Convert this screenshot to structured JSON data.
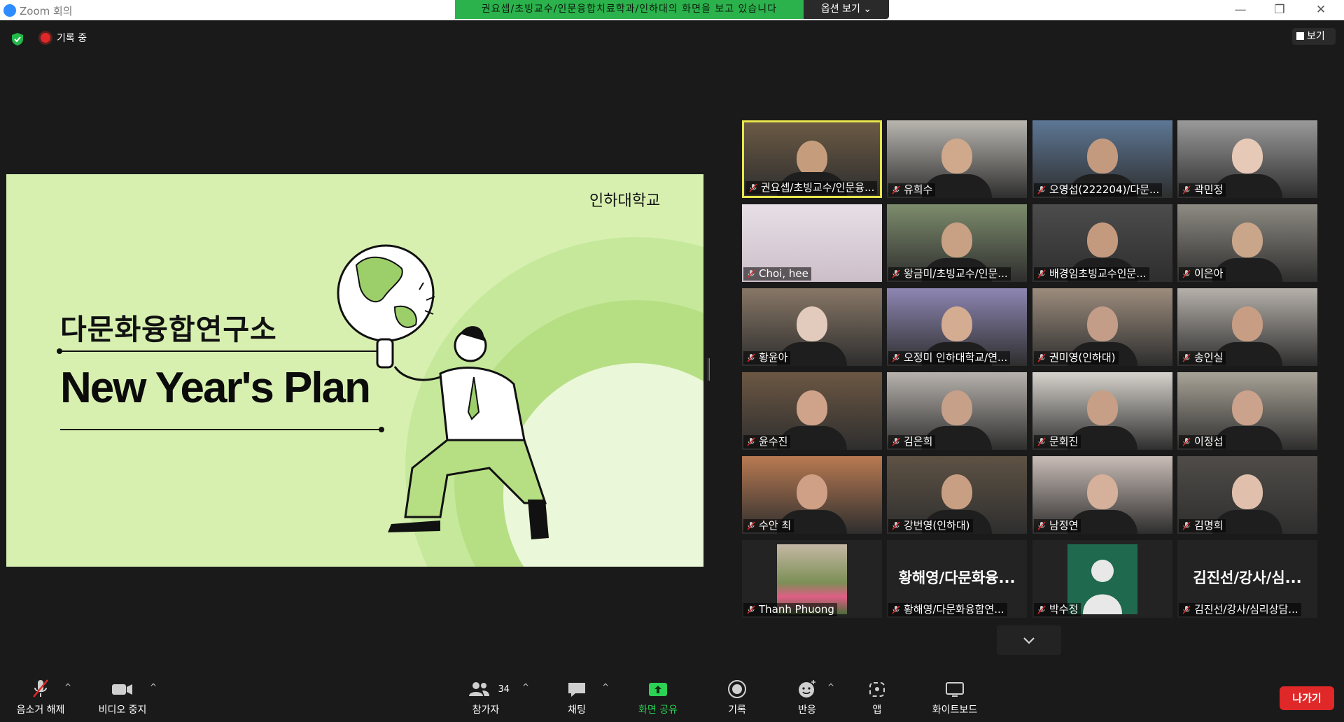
{
  "window": {
    "app_title": "Zoom 회의",
    "share_banner": "권요셉/초빙교수/인문융합치료학과/인하대의 화면을 보고 있습니다",
    "options_label": "옵션 보기 ⌄",
    "controls": {
      "minimize": "—",
      "restore": "❐",
      "close": "✕"
    }
  },
  "status": {
    "recording_label": "기록 중",
    "view_label": "보기"
  },
  "slide": {
    "org": "인하대학교",
    "heading": "다문화융합연구소",
    "title": "New Year's Plan"
  },
  "gallery": {
    "tiles": [
      {
        "name": "권요셉/초빙교수/인문융...",
        "style": "video"
      },
      {
        "name": "유희수",
        "style": "video"
      },
      {
        "name": "오영섭(222204)/다문...",
        "style": "video"
      },
      {
        "name": "곽민정",
        "style": "video"
      },
      {
        "name": "Choi, hee",
        "style": "blank"
      },
      {
        "name": "왕금미/초빙교수/인문...",
        "style": "video"
      },
      {
        "name": "배경임초빙교수인문...",
        "style": "video"
      },
      {
        "name": "이은아",
        "style": "video"
      },
      {
        "name": "황윤아",
        "style": "video"
      },
      {
        "name": "오정미 인하대학교/연...",
        "style": "video"
      },
      {
        "name": "권미영(인하대)",
        "style": "video"
      },
      {
        "name": "송인실",
        "style": "video"
      },
      {
        "name": "윤수진",
        "style": "video"
      },
      {
        "name": "김은희",
        "style": "video"
      },
      {
        "name": "문회진",
        "style": "video"
      },
      {
        "name": "이정섭",
        "style": "video"
      },
      {
        "name": "수안 최",
        "style": "video"
      },
      {
        "name": "강번영(인하대)",
        "style": "video"
      },
      {
        "name": "남정연",
        "style": "video"
      },
      {
        "name": "김명희",
        "style": "video"
      },
      {
        "name": "Thanh Phuong",
        "style": "photo"
      },
      {
        "name": "황해영/다문화융합연...",
        "big_name": "황해영/다문화융...",
        "style": "text"
      },
      {
        "name": "박수정",
        "style": "avatar"
      },
      {
        "name": "김진선/강사/심리상담...",
        "big_name": "김진선/강사/심...",
        "style": "text"
      }
    ]
  },
  "toolbar": {
    "mute": "음소거 해제",
    "video": "비디오 중지",
    "participants": "참가자",
    "participants_count": "34",
    "chat": "채팅",
    "share": "화면 공유",
    "record": "기록",
    "reactions": "반응",
    "apps": "앱",
    "whiteboard": "화이트보드",
    "leave": "나가기"
  },
  "colors": {
    "accent_green": "#2bb24c",
    "leave_red": "#e02828",
    "active_speaker": "#e8e64a",
    "slide_bg": "#d7f0b0"
  }
}
